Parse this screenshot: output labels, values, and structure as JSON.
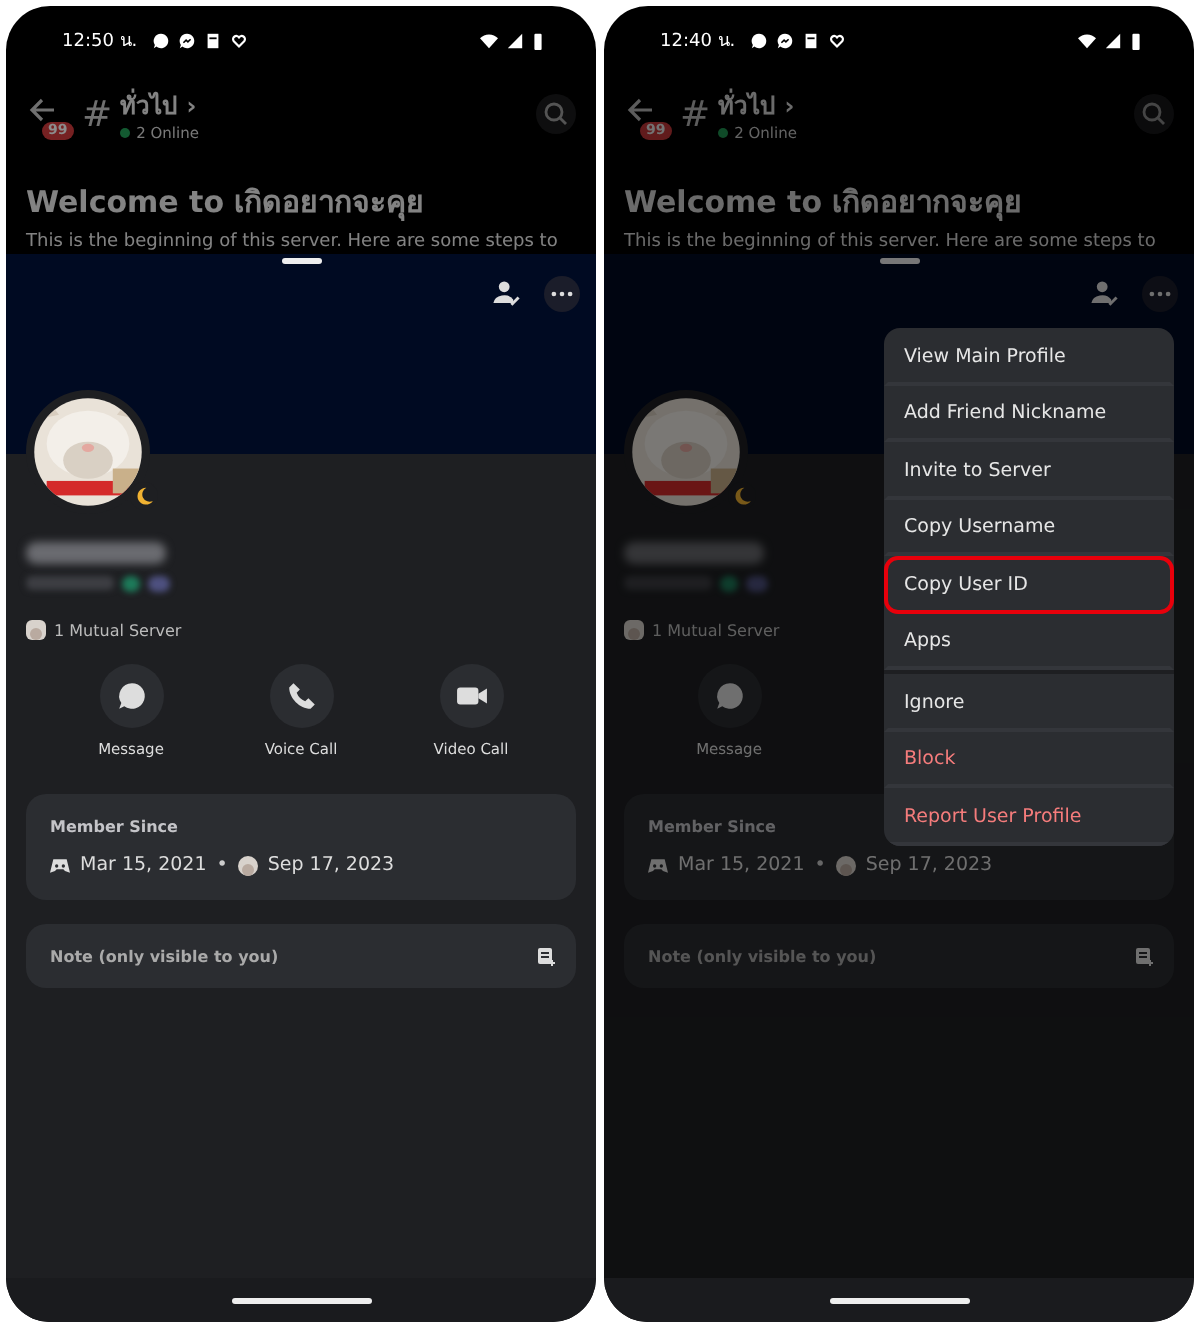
{
  "phones": [
    {
      "dimmed": false,
      "status_time": "12:50 น.",
      "header": {
        "badge": "99",
        "hash": "#",
        "channel": "ทั่วไป",
        "chevron": "›",
        "online": "2 Online"
      },
      "welcome": {
        "title": "Welcome to เกิดอยากจะคุย",
        "text": "This is the beginning of this server. Here are some steps to"
      },
      "profile": {
        "mutual": "1 Mutual Server",
        "actions": [
          {
            "kind": "message",
            "label": "Message"
          },
          {
            "kind": "voice",
            "label": "Voice Call"
          },
          {
            "kind": "video",
            "label": "Video Call"
          }
        ],
        "member_since": {
          "label": "Member Since",
          "discord_date": "Mar 15, 2021",
          "separator": "•",
          "server_date": "Sep 17, 2023"
        },
        "note": "Note (only visible to you)"
      }
    },
    {
      "dimmed": true,
      "status_time": "12:40 น.",
      "header": {
        "badge": "99",
        "hash": "#",
        "channel": "ทั่วไป",
        "chevron": "›",
        "online": "2 Online"
      },
      "welcome": {
        "title": "Welcome to เกิดอยากจะคุย",
        "text": "This is the beginning of this server. Here are some steps to"
      },
      "profile": {
        "mutual": "1 Mutual Server",
        "actions": [
          {
            "kind": "message",
            "label": "Message"
          }
        ],
        "member_since": {
          "label": "Member Since",
          "discord_date": "Mar 15, 2021",
          "separator": "•",
          "server_date": "Sep 17, 2023"
        },
        "note": "Note (only visible to you)"
      },
      "menu_sections": [
        {
          "items": [
            {
              "label": "View Main Profile",
              "kind": "normal",
              "highlighted": false
            },
            {
              "label": "Add Friend Nickname",
              "kind": "normal",
              "highlighted": false
            },
            {
              "label": "Invite to Server",
              "kind": "normal",
              "highlighted": false
            },
            {
              "label": "Copy Username",
              "kind": "normal",
              "highlighted": false
            },
            {
              "label": "Copy User ID",
              "kind": "normal",
              "highlighted": true
            },
            {
              "label": "Apps",
              "kind": "normal",
              "highlighted": false
            }
          ]
        },
        {
          "items": [
            {
              "label": "Ignore",
              "kind": "normal",
              "highlighted": false
            },
            {
              "label": "Block",
              "kind": "danger",
              "highlighted": false
            },
            {
              "label": "Report User Profile",
              "kind": "danger",
              "highlighted": false
            }
          ]
        }
      ]
    }
  ]
}
